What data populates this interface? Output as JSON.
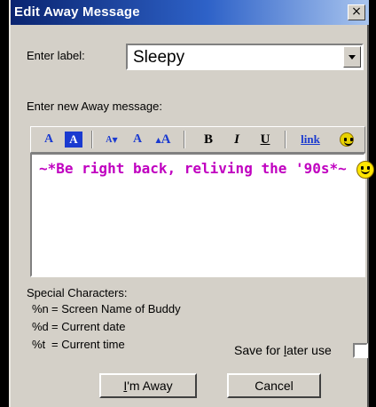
{
  "window": {
    "title": "Edit Away Message",
    "close_glyph": "×"
  },
  "label_field": {
    "label": "Enter label:",
    "value": "Sleepy"
  },
  "message_section": {
    "label": "Enter new Away message:"
  },
  "toolbar": {
    "text_color_label": "A",
    "background_color_label": "A",
    "smaller_font_label": "A",
    "normal_font_label": "A",
    "larger_font_label": "A",
    "bold_label": "B",
    "italic_label": "I",
    "underline_label": "U",
    "link_label": "link",
    "smiley_icon": "smiley-icon"
  },
  "editor": {
    "message": "~*Be right back, reliving the '90s*~",
    "message_color": "#c000c0"
  },
  "special_characters": {
    "heading": "Special Characters:",
    "items": [
      {
        "code": "%n",
        "meaning": "= Screen Name of Buddy"
      },
      {
        "code": "%d",
        "meaning": "= Current date"
      },
      {
        "code": "%t",
        "meaning": "= Current time"
      }
    ]
  },
  "save_option": {
    "label_before": "Save for ",
    "label_underlined": "l",
    "label_after": "ater use",
    "checked": false
  },
  "buttons": {
    "away_underlined": "I",
    "away_rest": "'m Away",
    "cancel": "Cancel"
  }
}
